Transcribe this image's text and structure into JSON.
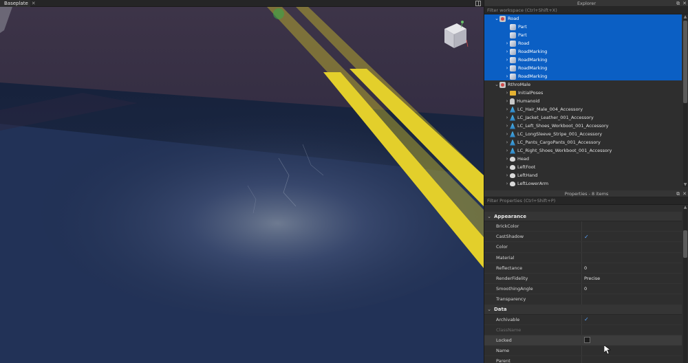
{
  "viewport": {
    "tab_label": "Baseplate",
    "tab_close": "✕"
  },
  "explorer": {
    "title": "Explorer",
    "filter_placeholder": "Filter workspace (Ctrl+Shift+X)",
    "items": [
      {
        "label": "Road",
        "icon": "model-icon",
        "indent": 1,
        "expand": "down",
        "selected": true
      },
      {
        "label": "Part",
        "icon": "part-icon",
        "indent": 2,
        "expand": "",
        "selected": true
      },
      {
        "label": "Part",
        "icon": "part-icon",
        "indent": 2,
        "expand": "",
        "selected": true
      },
      {
        "label": "Road",
        "icon": "part-icon",
        "indent": 2,
        "expand": "right",
        "selected": true
      },
      {
        "label": "RoadMarking",
        "icon": "part-icon",
        "indent": 2,
        "expand": "right",
        "selected": true
      },
      {
        "label": "RoadMarking",
        "icon": "part-icon",
        "indent": 2,
        "expand": "right",
        "selected": true
      },
      {
        "label": "RoadMarking",
        "icon": "part-icon",
        "indent": 2,
        "expand": "right",
        "selected": true
      },
      {
        "label": "RoadMarking",
        "icon": "part-icon",
        "indent": 2,
        "expand": "right",
        "selected": true
      },
      {
        "label": "RthroMale",
        "icon": "model-icon",
        "indent": 1,
        "expand": "down",
        "selected": false
      },
      {
        "label": "InitialPoses",
        "icon": "folder-icon",
        "indent": 2,
        "expand": "right",
        "selected": false
      },
      {
        "label": "Humanoid",
        "icon": "humanoid-icon",
        "indent": 2,
        "expand": "right",
        "selected": false
      },
      {
        "label": "LC_Hair_Male_004_Accessory",
        "icon": "accessory-icon",
        "indent": 2,
        "expand": "right",
        "selected": false
      },
      {
        "label": "LC_Jacket_Leather_001_Accessory",
        "icon": "accessory-icon",
        "indent": 2,
        "expand": "right",
        "selected": false
      },
      {
        "label": "LC_Left_Shoes_Workboot_001_Accessory",
        "icon": "accessory-icon",
        "indent": 2,
        "expand": "right",
        "selected": false
      },
      {
        "label": "LC_LongSleeve_Stripe_001_Accessory",
        "icon": "accessory-icon",
        "indent": 2,
        "expand": "right",
        "selected": false
      },
      {
        "label": "LC_Pants_CargoPants_001_Accessory",
        "icon": "accessory-icon",
        "indent": 2,
        "expand": "right",
        "selected": false
      },
      {
        "label": "LC_Right_Shoes_Workboot_001_Accessory",
        "icon": "accessory-icon",
        "indent": 2,
        "expand": "right",
        "selected": false
      },
      {
        "label": "Head",
        "icon": "meshpart-icon",
        "indent": 2,
        "expand": "right",
        "selected": false
      },
      {
        "label": "LeftFoot",
        "icon": "meshpart-icon",
        "indent": 2,
        "expand": "right",
        "selected": false
      },
      {
        "label": "LeftHand",
        "icon": "meshpart-icon",
        "indent": 2,
        "expand": "right",
        "selected": false
      },
      {
        "label": "LeftLowerArm",
        "icon": "meshpart-icon",
        "indent": 2,
        "expand": "right",
        "selected": false
      }
    ]
  },
  "properties": {
    "title": "Properties - 8 items",
    "filter_placeholder": "Filter Properties (Ctrl+Shift+P)",
    "categories": [
      {
        "name": "Appearance",
        "props": [
          {
            "name": "BrickColor",
            "value": "",
            "type": "text"
          },
          {
            "name": "CastShadow",
            "value": "",
            "type": "checked"
          },
          {
            "name": "Color",
            "value": "",
            "type": "text"
          },
          {
            "name": "Material",
            "value": "",
            "type": "text"
          },
          {
            "name": "Reflectance",
            "value": "0",
            "type": "text"
          },
          {
            "name": "RenderFidelity",
            "value": "Precise",
            "type": "text"
          },
          {
            "name": "SmoothingAngle",
            "value": "0",
            "type": "text"
          },
          {
            "name": "Transparency",
            "value": "",
            "type": "text"
          }
        ]
      },
      {
        "name": "Data",
        "props": [
          {
            "name": "Archivable",
            "value": "",
            "type": "checked"
          },
          {
            "name": "ClassName",
            "value": "",
            "type": "dim"
          },
          {
            "name": "Locked",
            "value": "",
            "type": "unchecked",
            "hover": true
          },
          {
            "name": "Name",
            "value": "",
            "type": "text"
          },
          {
            "name": "Parent",
            "value": "",
            "type": "text"
          }
        ]
      }
    ]
  },
  "colors": {
    "selection": "#0b5fc4",
    "road_line": "#d8c728",
    "asphalt": "#1f2d4a",
    "check": "#5aa4ff"
  }
}
